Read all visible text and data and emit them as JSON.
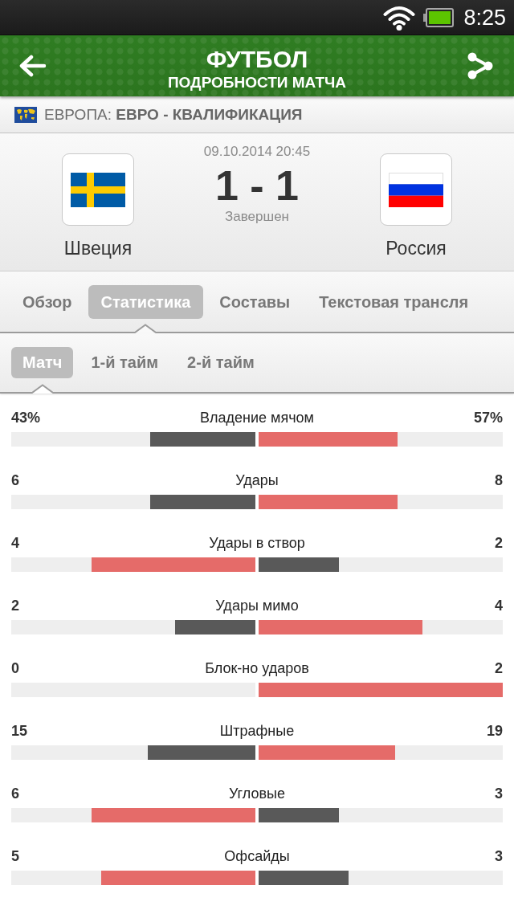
{
  "status_bar": {
    "time": "8:25"
  },
  "header": {
    "title": "ФУТБОЛ",
    "subtitle": "ПОДРОБНОСТИ МАТЧА"
  },
  "league": {
    "text": "ЕВРОПА: **ЕВРО - КВАЛИФИКАЦИЯ**"
  },
  "match": {
    "datetime": "09.10.2014 20:45",
    "score": "1 - 1",
    "status": "Завершен",
    "home": {
      "name": "Швеция"
    },
    "away": {
      "name": "Россия"
    }
  },
  "tabs": [
    {
      "label": "Обзор",
      "selected": false
    },
    {
      "label": "Статистика",
      "selected": true
    },
    {
      "label": "Составы",
      "selected": false
    },
    {
      "label": "Текстовая трансля",
      "selected": false
    }
  ],
  "period_tabs": [
    {
      "label": "Матч",
      "selected": true
    },
    {
      "label": "1-й тайм",
      "selected": false
    },
    {
      "label": "2-й тайм",
      "selected": false
    }
  ],
  "stats": [
    {
      "label": "Владение мячом",
      "home": {
        "value": "43%",
        "level": 0.43,
        "leading": false
      },
      "away": {
        "value": "57%",
        "level": 0.57,
        "leading": true
      }
    },
    {
      "label": "Удары",
      "home": {
        "value": "6",
        "level": 0.43,
        "leading": false
      },
      "away": {
        "value": "8",
        "level": 0.57,
        "leading": true
      }
    },
    {
      "label": "Удары в створ",
      "home": {
        "value": "4",
        "level": 0.67,
        "leading": true
      },
      "away": {
        "value": "2",
        "level": 0.33,
        "leading": false
      }
    },
    {
      "label": "Удары мимо",
      "home": {
        "value": "2",
        "level": 0.33,
        "leading": false
      },
      "away": {
        "value": "4",
        "level": 0.67,
        "leading": true
      }
    },
    {
      "label": "Блок-но ударов",
      "home": {
        "value": "0"
      },
      "away": {
        "value": "2",
        "level": 1,
        "leading": true
      }
    },
    {
      "label": "Штрафные",
      "home": {
        "value": "15",
        "level": 0.44,
        "leading": false
      },
      "away": {
        "value": "19",
        "level": 0.56,
        "leading": true
      }
    },
    {
      "label": "Угловые",
      "home": {
        "value": "6",
        "level": 0.67,
        "leading": true
      },
      "away": {
        "value": "3",
        "level": 0.33,
        "leading": false
      }
    },
    {
      "label": "Офсайды",
      "home": {
        "value": "5",
        "level": 0.63,
        "leading": true
      },
      "away": {
        "value": "3",
        "level": 0.37,
        "leading": false
      }
    }
  ]
}
